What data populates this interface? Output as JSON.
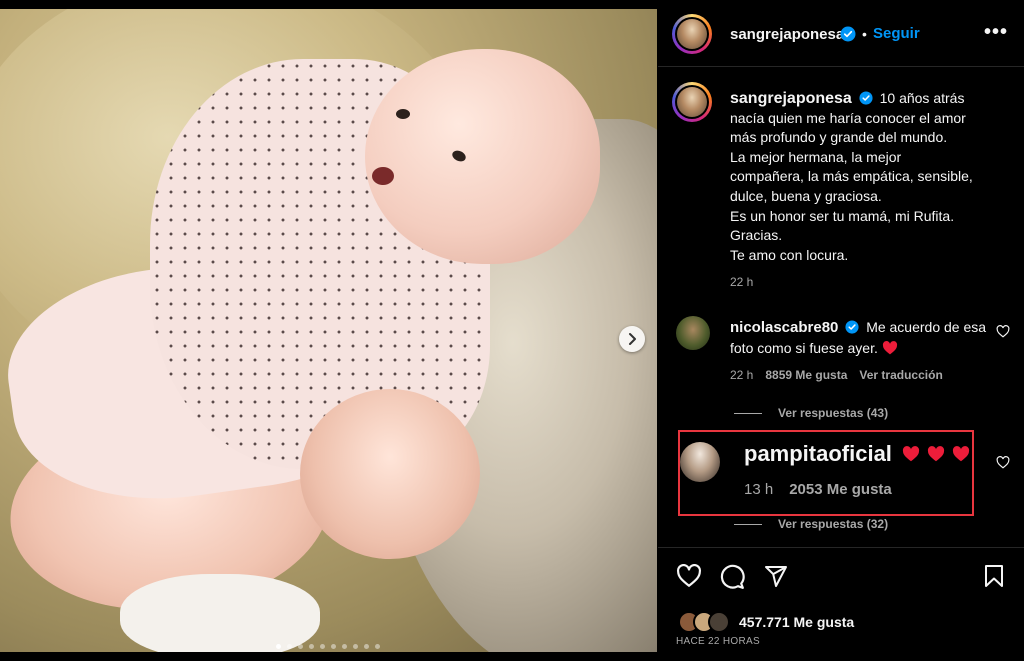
{
  "post": {
    "account": "sangrejaponesa",
    "follow_label": "Seguir",
    "dot": "•",
    "more": "•••",
    "caption_lines": [
      "10 años atrás",
      "nacía quien me haría conocer el amor",
      "más profundo y grande del mundo.",
      "La mejor hermana, la mejor",
      "compañera, la más empática, sensible,",
      "dulce, buena y graciosa.",
      "Es un honor ser tu mamá, mi Rufita.",
      "Gracias.",
      "Te amo con locura."
    ],
    "caption_time": "22 h",
    "image_count": 10,
    "active_image": 0
  },
  "comments": [
    {
      "username": "nicolascabre80",
      "text": "Me acuerdo de esa foto como si fuese ayer.",
      "emoji": "heart",
      "time": "22 h",
      "likes": "8859 Me gusta",
      "translate": "Ver traducción",
      "replies": "Ver respuestas (43)"
    },
    {
      "username": "pampitaoficial",
      "time": "13 h",
      "likes": "2053 Me gusta",
      "hearts": 3,
      "replies": "Ver respuestas (32)"
    }
  ],
  "footer": {
    "likes": "457.771 Me gusta",
    "time_ago": "HACE 22 HORAS"
  },
  "colors": {
    "accent_blue": "#0095f6",
    "heart_red": "#ed1d3a",
    "highlight_border": "#e8363f",
    "muted_text": "#a8a8a8"
  },
  "icons": [
    "verified-badge-icon",
    "chevron-right-icon",
    "heart-outline-icon",
    "comment-icon",
    "share-icon",
    "bookmark-icon",
    "heart-filled-icon"
  ]
}
